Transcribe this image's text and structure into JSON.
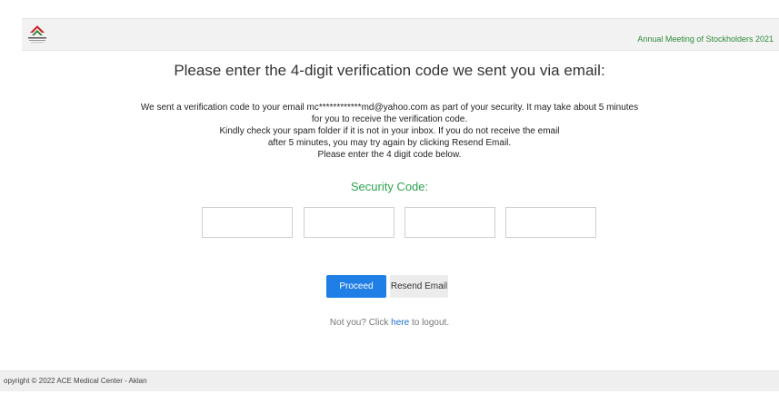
{
  "header": {
    "event_title": "Annual Meeting of Stockholders 2021"
  },
  "main": {
    "heading": "Please enter the 4-digit verification code we sent you via email:",
    "instructions": [
      "We sent a verification code to your email mc************md@yahoo.com as part of your security. It may take about 5 minutes",
      "for you to receive the verification code.",
      "Kindly check your spam folder if it is not in your inbox. If you do not receive the email",
      "after 5 minutes, you may try again by clicking Resend Email.",
      "Please enter the 4 digit code below."
    ],
    "security_code_label": "Security Code:",
    "code_inputs": [
      "",
      "",
      "",
      ""
    ],
    "proceed_label": "Proceed",
    "resend_label": "Resend Email",
    "logout_prefix": "Not you? Click ",
    "logout_link": "here",
    "logout_suffix": " to logout."
  },
  "footer": {
    "copyright": "opyright © 2022 ACE Medical Center - Aklan"
  },
  "colors": {
    "accent_green": "#2ea44f",
    "primary_blue": "#1f7fe6",
    "link_blue": "#1f6fd6"
  },
  "icons": {
    "logo": "company-logo-icon"
  }
}
